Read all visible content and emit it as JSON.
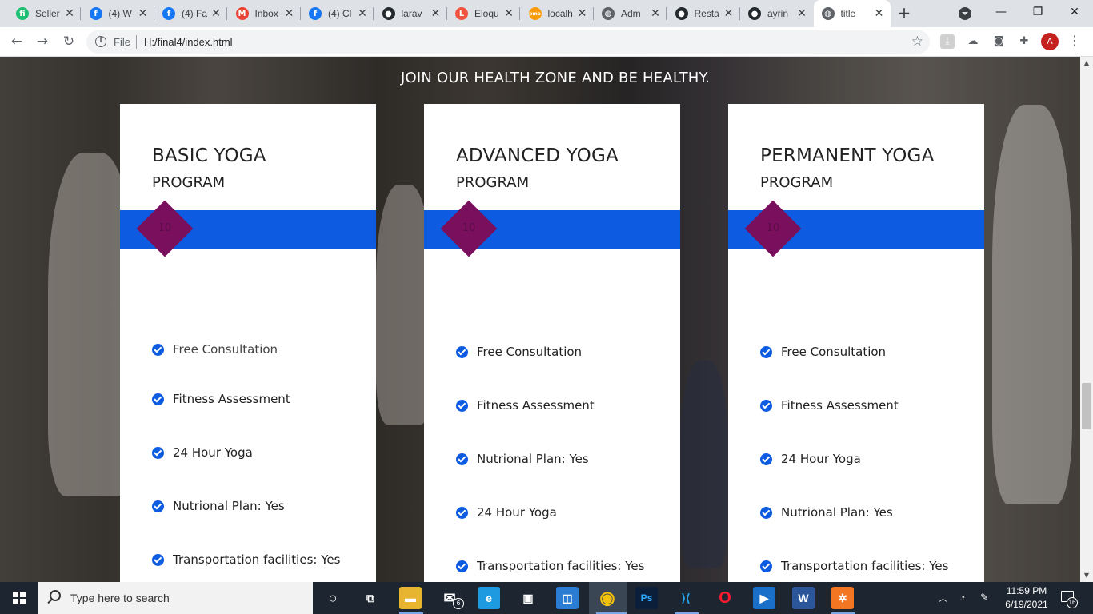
{
  "browser": {
    "tabs": [
      {
        "title": "Seller",
        "icon": "fiverr-icon",
        "color": "#1dbf73",
        "glyph": "fi"
      },
      {
        "title": "(4) W",
        "icon": "facebook-icon",
        "color": "#1877f2",
        "glyph": "f"
      },
      {
        "title": "(4) Fa",
        "icon": "facebook-icon",
        "color": "#1877f2",
        "glyph": "f"
      },
      {
        "title": "Inbox",
        "icon": "gmail-icon",
        "color": "#ea4335",
        "glyph": "M"
      },
      {
        "title": "(4) Cl",
        "icon": "facebook-icon",
        "color": "#1877f2",
        "glyph": "f"
      },
      {
        "title": "larav",
        "icon": "github-icon",
        "color": "#24292e",
        "glyph": "●"
      },
      {
        "title": "Eloqu",
        "icon": "laravel-icon",
        "color": "#f05340",
        "glyph": "L"
      },
      {
        "title": "localh",
        "icon": "phpmyadmin-icon",
        "color": "#f89c0e",
        "glyph": "pma"
      },
      {
        "title": "Adm",
        "icon": "globe-icon",
        "color": "#5f6368",
        "glyph": "◍"
      },
      {
        "title": "Resta",
        "icon": "github-icon",
        "color": "#24292e",
        "glyph": "●"
      },
      {
        "title": "ayrin",
        "icon": "github-icon",
        "color": "#24292e",
        "glyph": "●"
      },
      {
        "title": "title",
        "icon": "globe-icon",
        "color": "#5f6368",
        "glyph": "◍",
        "active": true
      }
    ],
    "close_glyph": "✕",
    "new_tab_glyph": "+",
    "window_controls": {
      "minimize": "—",
      "maximize": "❐",
      "close": "✕"
    },
    "toolbar": {
      "back": "←",
      "forward": "→",
      "reload": "↻",
      "scheme_label": "File",
      "url": "H:/final4/index.html",
      "star": "☆",
      "profile_initial": "A",
      "menu": "⋮"
    }
  },
  "page": {
    "headline": "JOIN OUR HEALTH ZONE AND BE HEALTHY.",
    "cards": [
      {
        "title": "BASIC YOGA",
        "subtitle": "PROGRAM",
        "price": "10",
        "features": [
          "Free Consultation",
          "Fitness Assessment",
          "24 Hour Yoga",
          "Nutrional Plan: Yes",
          "Transportation facilities: Yes"
        ]
      },
      {
        "title": "ADVANCED YOGA",
        "subtitle": "PROGRAM",
        "price": "10",
        "features": [
          "Free Consultation",
          "Fitness Assessment",
          "Nutrional Plan: Yes",
          "24 Hour Yoga",
          "Transportation facilities: Yes"
        ]
      },
      {
        "title": "PERMANENT YOGA",
        "subtitle": "PROGRAM",
        "price": "10",
        "features": [
          "Free Consultation",
          "Fitness Assessment",
          "24 Hour Yoga",
          "Nutrional Plan: Yes",
          "Transportation facilities: Yes"
        ]
      }
    ],
    "colors": {
      "band": "#0d5be0",
      "diamond": "#7a0f5e",
      "check": "#0d5be0"
    }
  },
  "taskbar": {
    "search_placeholder": "Type here to search",
    "mail_badge": "6",
    "apps": [
      {
        "name": "task-view-icon",
        "glyph": "⧉",
        "color": "transparent"
      },
      {
        "name": "file-explorer-icon",
        "glyph": "▬",
        "color": "#e8b530"
      },
      {
        "name": "mail-icon",
        "glyph": "✉",
        "color": "transparent"
      },
      {
        "name": "edge-icon",
        "glyph": "e",
        "color": "#1e9be0"
      },
      {
        "name": "store-icon",
        "glyph": "▣",
        "color": "transparent"
      },
      {
        "name": "sticky-app-icon",
        "glyph": "◫",
        "color": "#2b7cd3"
      },
      {
        "name": "chrome-icon",
        "glyph": "◉",
        "color": "transparent"
      },
      {
        "name": "photoshop-icon",
        "glyph": "Ps",
        "color": "#0b1f3a"
      },
      {
        "name": "vscode-icon",
        "glyph": "⟩⟨",
        "color": "transparent"
      },
      {
        "name": "opera-icon",
        "glyph": "O",
        "color": "transparent"
      },
      {
        "name": "media-player-icon",
        "glyph": "▶",
        "color": "#1a6fc9"
      },
      {
        "name": "word-icon",
        "glyph": "W",
        "color": "#2b579a"
      },
      {
        "name": "xampp-icon",
        "glyph": "✲",
        "color": "#f37623"
      }
    ],
    "time": "11:59 PM",
    "date": "6/19/2021",
    "notification_count": "16"
  }
}
